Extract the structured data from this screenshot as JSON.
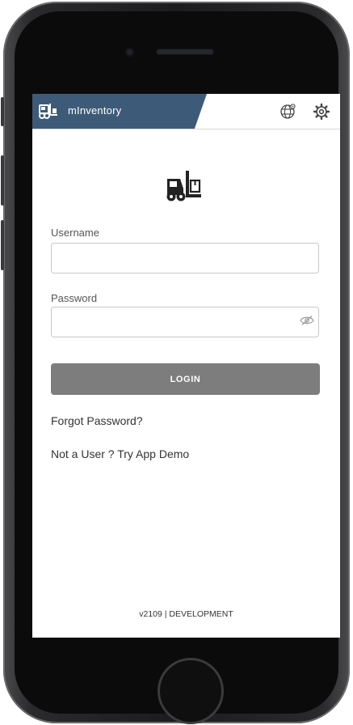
{
  "app": {
    "title": "mInventory"
  },
  "header": {
    "icons": [
      "forklift-icon",
      "globe-icon",
      "gear-icon"
    ]
  },
  "form": {
    "username_label": "Username",
    "username_value": "",
    "password_label": "Password",
    "password_value": "",
    "login_label": "LOGIN"
  },
  "links": {
    "forgot_password": "Forgot Password?",
    "demo": "Not a User ? Try App Demo"
  },
  "footer": {
    "version": "v2109 | DEVELOPMENT"
  },
  "colors": {
    "header_brand": "#3d5b78",
    "login_button": "#7d7d7d",
    "phone_frame": "#1c1c1e"
  }
}
